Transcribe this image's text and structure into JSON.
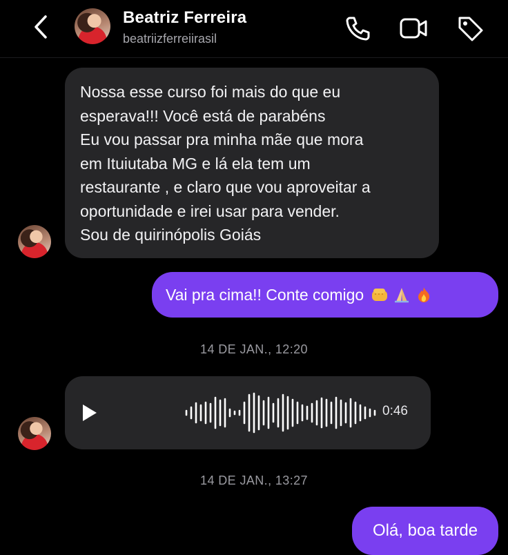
{
  "header": {
    "name": "Beatriz Ferreira",
    "username": "beatriizferreiirasil",
    "back_icon": "chevron-left-icon",
    "call_icon": "phone-icon",
    "video_icon": "video-camera-icon",
    "tag_icon": "tag-icon"
  },
  "messages": {
    "incoming_1": {
      "lines": [
        "Nossa esse curso foi mais do que eu",
        "esperava!!! Você está de parabéns",
        "Eu vou passar pra minha mãe que mora",
        "em Ituiutaba MG e lá ela tem um",
        "restaurante , e claro que vou aproveitar a",
        "oportunidade e irei usar para vender.",
        "Sou de quirinópolis Goiás"
      ]
    },
    "outgoing_1": {
      "text": "Vai pra cima!! Conte comigo",
      "emojis": [
        "oncoming-fist-emoji",
        "folded-hands-emoji",
        "fire-emoji"
      ]
    },
    "timestamp_1": "14 DE JAN., 12:20",
    "voice": {
      "duration": "0:46",
      "play_icon": "play-icon"
    },
    "timestamp_2": "14 DE JAN., 13:27",
    "outgoing_2": {
      "text": "Olá, boa tarde"
    }
  },
  "colors": {
    "background": "#000000",
    "incoming_bubble": "#262628",
    "outgoing_bubble": "#7a3ff0"
  }
}
